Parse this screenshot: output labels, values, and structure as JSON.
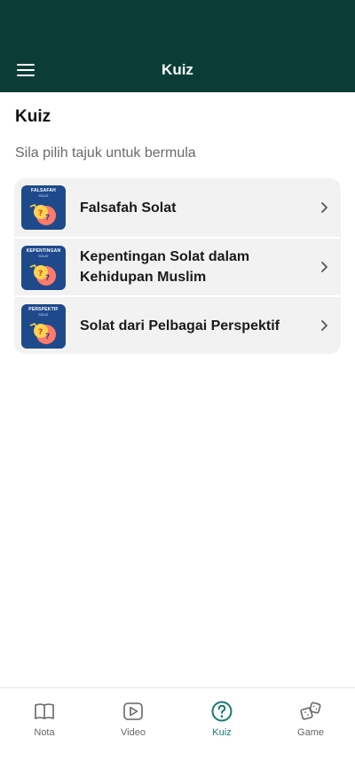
{
  "header": {
    "title": "Kuiz",
    "menu_icon": "hamburger-menu-icon",
    "background": "#0b3d36"
  },
  "main": {
    "title": "Kuiz",
    "subtitle": "Sila pilih tajuk untuk bermula",
    "topics": [
      {
        "label": "Falsafah Solat",
        "thumb_title": "FALSAFAH",
        "thumb_sub": "SOLAT"
      },
      {
        "label": "Kepentingan Solat dalam Kehidupan Muslim",
        "thumb_title": "KEPENTINGAN",
        "thumb_sub": "SOLAT"
      },
      {
        "label": "Solat dari Pelbagai Perspektif",
        "thumb_title": "PERSPEKTIF",
        "thumb_sub": "SOLAT"
      }
    ]
  },
  "bottom_nav": {
    "active": "Kuiz",
    "accent": "#157a73",
    "tabs": [
      {
        "label": "Nota",
        "icon": "book-icon"
      },
      {
        "label": "Video",
        "icon": "play-icon"
      },
      {
        "label": "Kuiz",
        "icon": "question-circle-icon"
      },
      {
        "label": "Game",
        "icon": "dice-icon"
      }
    ]
  }
}
